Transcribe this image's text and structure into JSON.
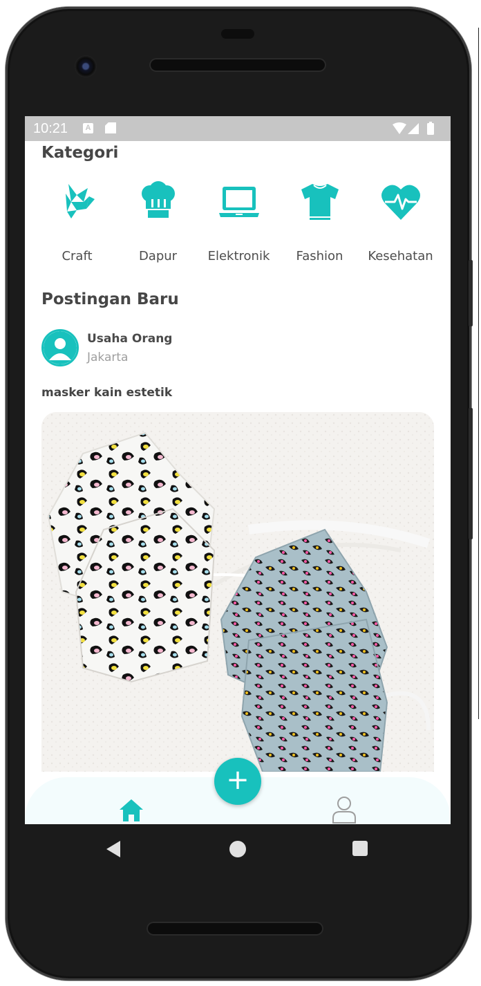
{
  "status_bar": {
    "time": "10:21",
    "notification_a": "A",
    "icons": [
      "sd-card-icon",
      "wifi-icon",
      "cell-signal-icon",
      "battery-icon"
    ]
  },
  "categories_section": {
    "title": "Kategori",
    "items": [
      {
        "label": "Craft",
        "icon": "origami-bird-icon"
      },
      {
        "label": "Dapur",
        "icon": "chef-hat-icon"
      },
      {
        "label": "Elektronik",
        "icon": "laptop-icon"
      },
      {
        "label": "Fashion",
        "icon": "tshirt-icon"
      },
      {
        "label": "Kesehatan",
        "icon": "heart-pulse-icon"
      }
    ]
  },
  "posts_section": {
    "title": "Postingan Baru",
    "post": {
      "user_name": "Usaha Orang",
      "location": "Jakarta",
      "title": "masker kain estetik",
      "image": "leopard-print-face-masks-photo"
    }
  },
  "bottom_nav": {
    "fab_label": "+",
    "items": [
      "home-icon",
      "profile-icon"
    ]
  },
  "colors": {
    "accent": "#18c1bd",
    "status_bar": "#c6c6c6",
    "nav_background": "#f3fcfd",
    "text_dark": "#464646",
    "text_muted": "#9e9e9e"
  }
}
